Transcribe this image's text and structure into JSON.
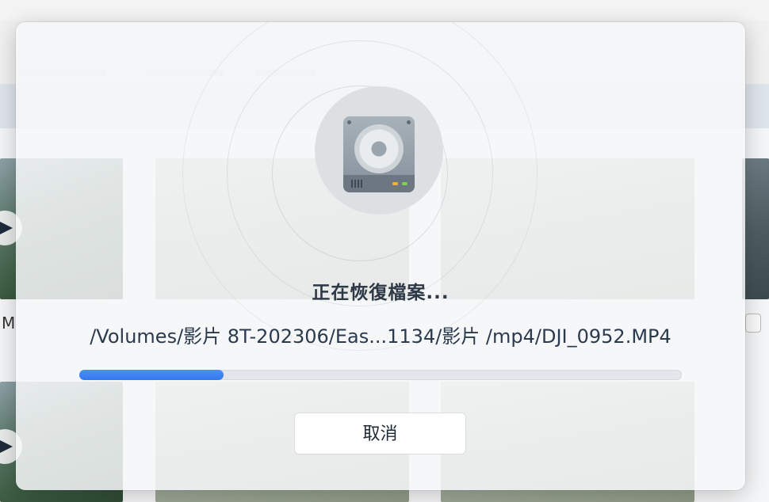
{
  "background": {
    "partial_label": "M",
    "thumbnails": [
      "video-thumbnail",
      "video-thumbnail",
      "video-thumbnail",
      "video-thumbnail"
    ]
  },
  "dialog": {
    "icon": "hard-drive-icon",
    "status_title": "正在恢復檔案...",
    "file_path": "/Volumes/影片 8T-202306/Eas...1134/影片 /mp4/DJI_0952.MP4",
    "progress_fraction": 0.24,
    "cancel_label": "取消",
    "accent_color": "#3478f0"
  }
}
